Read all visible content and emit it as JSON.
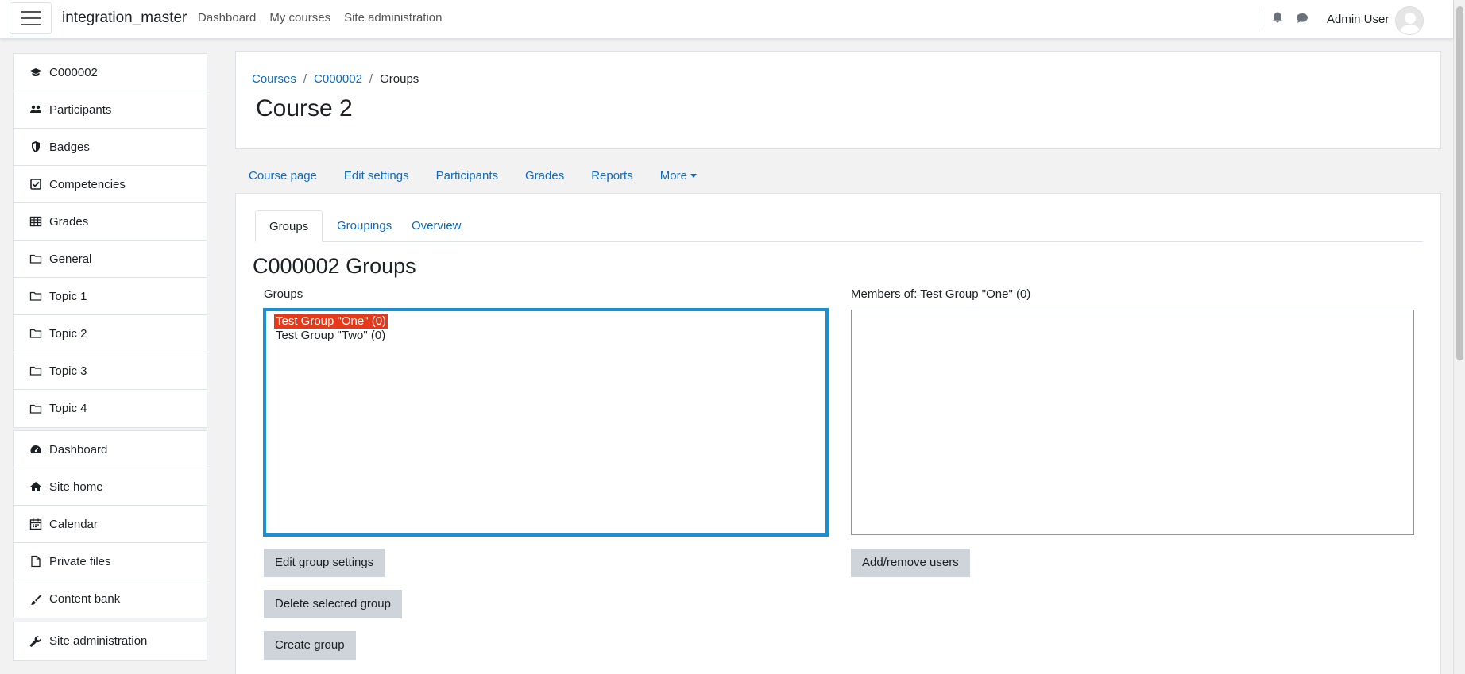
{
  "navbar": {
    "brand": "integration_master",
    "links": [
      "Dashboard",
      "My courses",
      "Site administration"
    ],
    "user_name": "Admin User"
  },
  "drawer": {
    "course_items": [
      {
        "label": "C000002",
        "icon": "graduation-cap-icon"
      },
      {
        "label": "Participants",
        "icon": "users-icon"
      },
      {
        "label": "Badges",
        "icon": "shield-icon"
      },
      {
        "label": "Competencies",
        "icon": "check-square-icon"
      },
      {
        "label": "Grades",
        "icon": "table-icon"
      },
      {
        "label": "General",
        "icon": "folder-icon"
      },
      {
        "label": "Topic 1",
        "icon": "folder-icon"
      },
      {
        "label": "Topic 2",
        "icon": "folder-icon"
      },
      {
        "label": "Topic 3",
        "icon": "folder-icon"
      },
      {
        "label": "Topic 4",
        "icon": "folder-icon"
      }
    ],
    "site_items": [
      {
        "label": "Dashboard",
        "icon": "dashboard-icon"
      },
      {
        "label": "Site home",
        "icon": "home-icon"
      },
      {
        "label": "Calendar",
        "icon": "calendar-icon"
      },
      {
        "label": "Private files",
        "icon": "file-icon"
      },
      {
        "label": "Content bank",
        "icon": "paint-brush-icon"
      }
    ],
    "admin_items": [
      {
        "label": "Site administration",
        "icon": "wrench-icon"
      }
    ]
  },
  "header": {
    "breadcrumb": [
      "Courses",
      "C000002",
      "Groups"
    ],
    "title": "Course 2"
  },
  "secondary_nav": {
    "items": [
      "Course page",
      "Edit settings",
      "Participants",
      "Grades",
      "Reports"
    ],
    "more_label": "More"
  },
  "tabs": [
    "Groups",
    "Groupings",
    "Overview"
  ],
  "groups_page": {
    "heading": "C000002 Groups",
    "groups_label": "Groups",
    "groups": [
      {
        "label": "Test Group \"One\" (0)",
        "selected": true
      },
      {
        "label": "Test Group \"Two\" (0)",
        "selected": false
      }
    ],
    "members_label": "Members of: Test Group \"One\" (0)",
    "buttons": {
      "edit_group": "Edit group settings",
      "delete_group": "Delete selected group",
      "create_group": "Create group",
      "add_remove_users": "Add/remove users"
    }
  },
  "colors": {
    "link": "#0f6cbf",
    "selection": "#e53919",
    "focus_border": "#1b8fd3",
    "button": "#ced4da"
  }
}
